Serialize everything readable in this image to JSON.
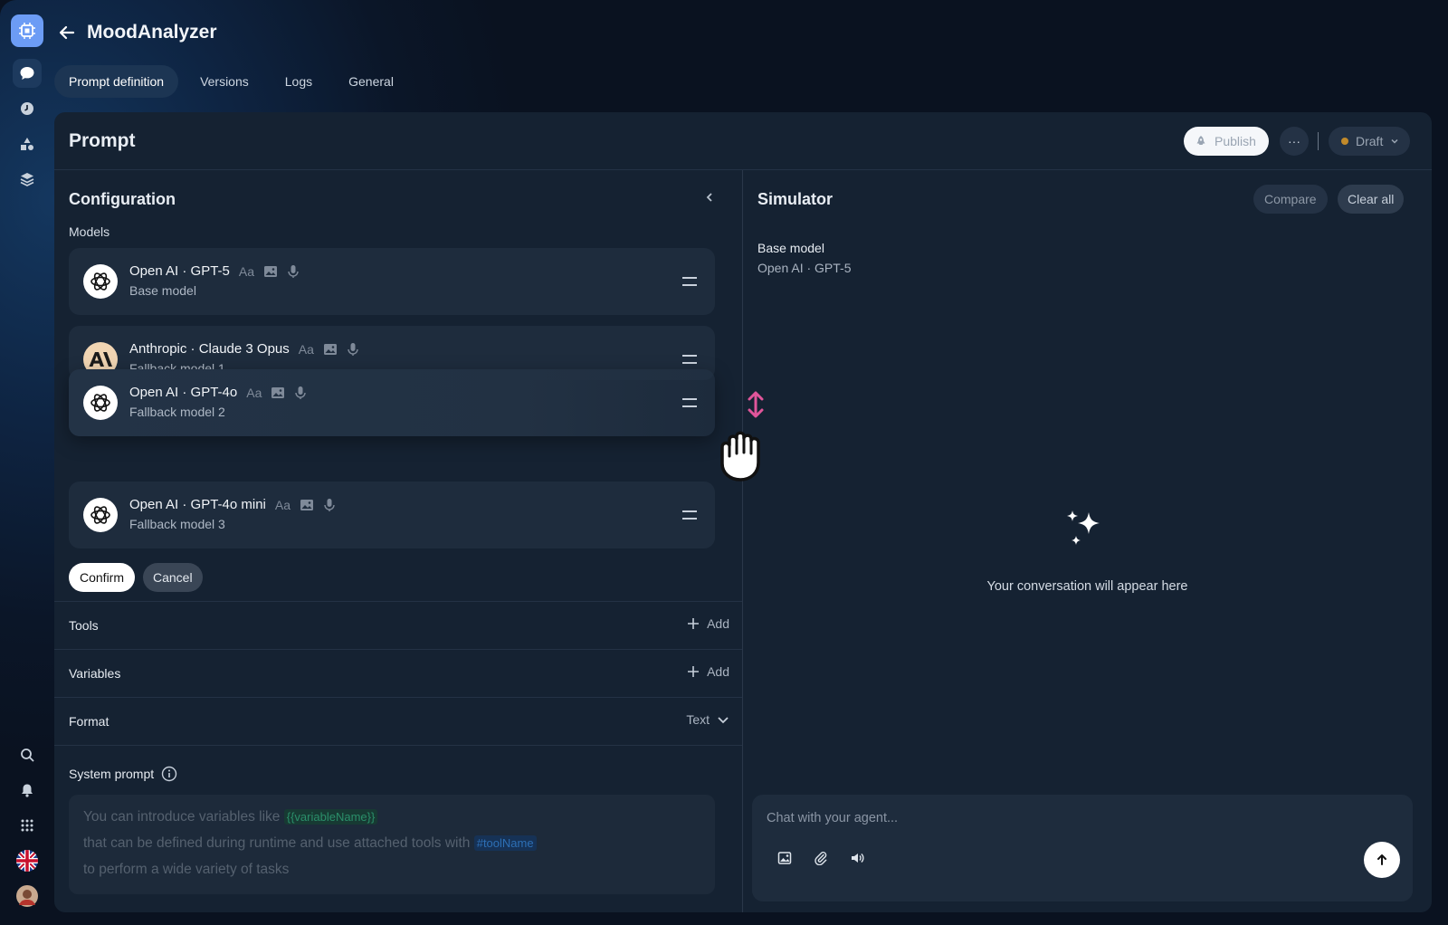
{
  "app": {
    "title": "MoodAnalyzer"
  },
  "tabs": [
    {
      "label": "Prompt definition",
      "active": true
    },
    {
      "label": "Versions",
      "active": false
    },
    {
      "label": "Logs",
      "active": false
    },
    {
      "label": "General",
      "active": false
    }
  ],
  "prompt": {
    "title": "Prompt",
    "publish_label": "Publish",
    "more_label": "···",
    "status_label": "Draft",
    "status_color": "#c28a2a"
  },
  "config": {
    "title": "Configuration",
    "models_label": "Models",
    "models": [
      {
        "name": "Open AI · GPT-5",
        "role": "Base model",
        "provider_icon": "openai-icon"
      },
      {
        "name": "Anthropic · Claude 3 Opus",
        "role": "Fallback model 1",
        "provider_icon": "anthropic-icon"
      },
      {
        "name": "Open AI · GPT-4o",
        "role": "Fallback model 2",
        "provider_icon": "openai-icon"
      },
      {
        "name": "Open AI · GPT-4o mini",
        "role": "Fallback model 3",
        "provider_icon": "openai-icon"
      }
    ],
    "cap_text": "Aa",
    "confirm_label": "Confirm",
    "cancel_label": "Cancel",
    "tools_label": "Tools",
    "variables_label": "Variables",
    "add_label": "Add",
    "format_label": "Format",
    "format_value": "Text",
    "system_prompt_label": "System prompt",
    "system_prompt_placeholder": {
      "line1": "You can introduce variables like",
      "var_chip": "{{variableName}}",
      "line2a": "that can be defined during runtime and use  attached tools with",
      "tool_chip": "#toolName",
      "line3": "to perform a wide variety of tasks"
    }
  },
  "simulator": {
    "title": "Simulator",
    "compare_label": "Compare",
    "clear_label": "Clear all",
    "base_model_label": "Base model",
    "base_model_value": "Open AI · GPT-5",
    "empty_text": "Your conversation will appear here",
    "chat_placeholder": "Chat with your agent..."
  },
  "colors": {
    "accent": "#6c9cf5",
    "drag_arrow": "#e0559a"
  }
}
